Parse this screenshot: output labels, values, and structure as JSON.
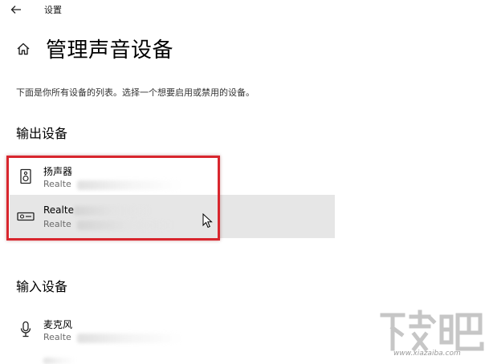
{
  "window": {
    "title": "设置"
  },
  "page": {
    "title": "管理声音设备",
    "description": "下面是你所有设备的列表。选择一个想要启用或禁用的设备。"
  },
  "sections": {
    "output": {
      "title": "输出设备",
      "devices": [
        {
          "name": "扬声器",
          "sub": "Realte",
          "icon": "speaker-icon"
        },
        {
          "name": "Realte",
          "sub": "Realte",
          "icon": "digital-output-icon"
        }
      ]
    },
    "input": {
      "title": "输入设备",
      "devices": [
        {
          "name": "麦克风",
          "sub": "Realte",
          "icon": "microphone-icon"
        }
      ]
    }
  },
  "watermark": {
    "text": "下载吧",
    "url": "www.xiazaiba.com"
  },
  "colors": {
    "highlight": "#d8262e",
    "hover_background": "#e6e6e6",
    "secondary_text": "#6b6b6b"
  }
}
